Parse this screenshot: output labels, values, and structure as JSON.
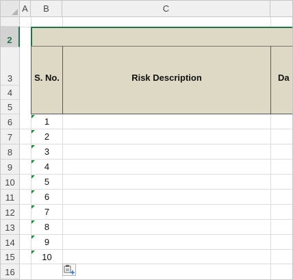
{
  "columns": {
    "a": "A",
    "b": "B",
    "c": "C"
  },
  "rows": [
    "2",
    "3",
    "4",
    "5",
    "6",
    "7",
    "8",
    "9",
    "10",
    "11",
    "12",
    "13",
    "14",
    "15",
    "16"
  ],
  "table": {
    "header_sno": "S. No.",
    "header_risk": "Risk Description",
    "header_d_partial": "Da",
    "serials": [
      "1",
      "2",
      "3",
      "4",
      "5",
      "6",
      "7",
      "8",
      "9",
      "10"
    ]
  },
  "icons": {
    "paste_options": "paste-options-icon"
  },
  "colors": {
    "selection": "#217346",
    "header_fill": "#ddd9c4",
    "error_marker": "#1a8c3a"
  }
}
